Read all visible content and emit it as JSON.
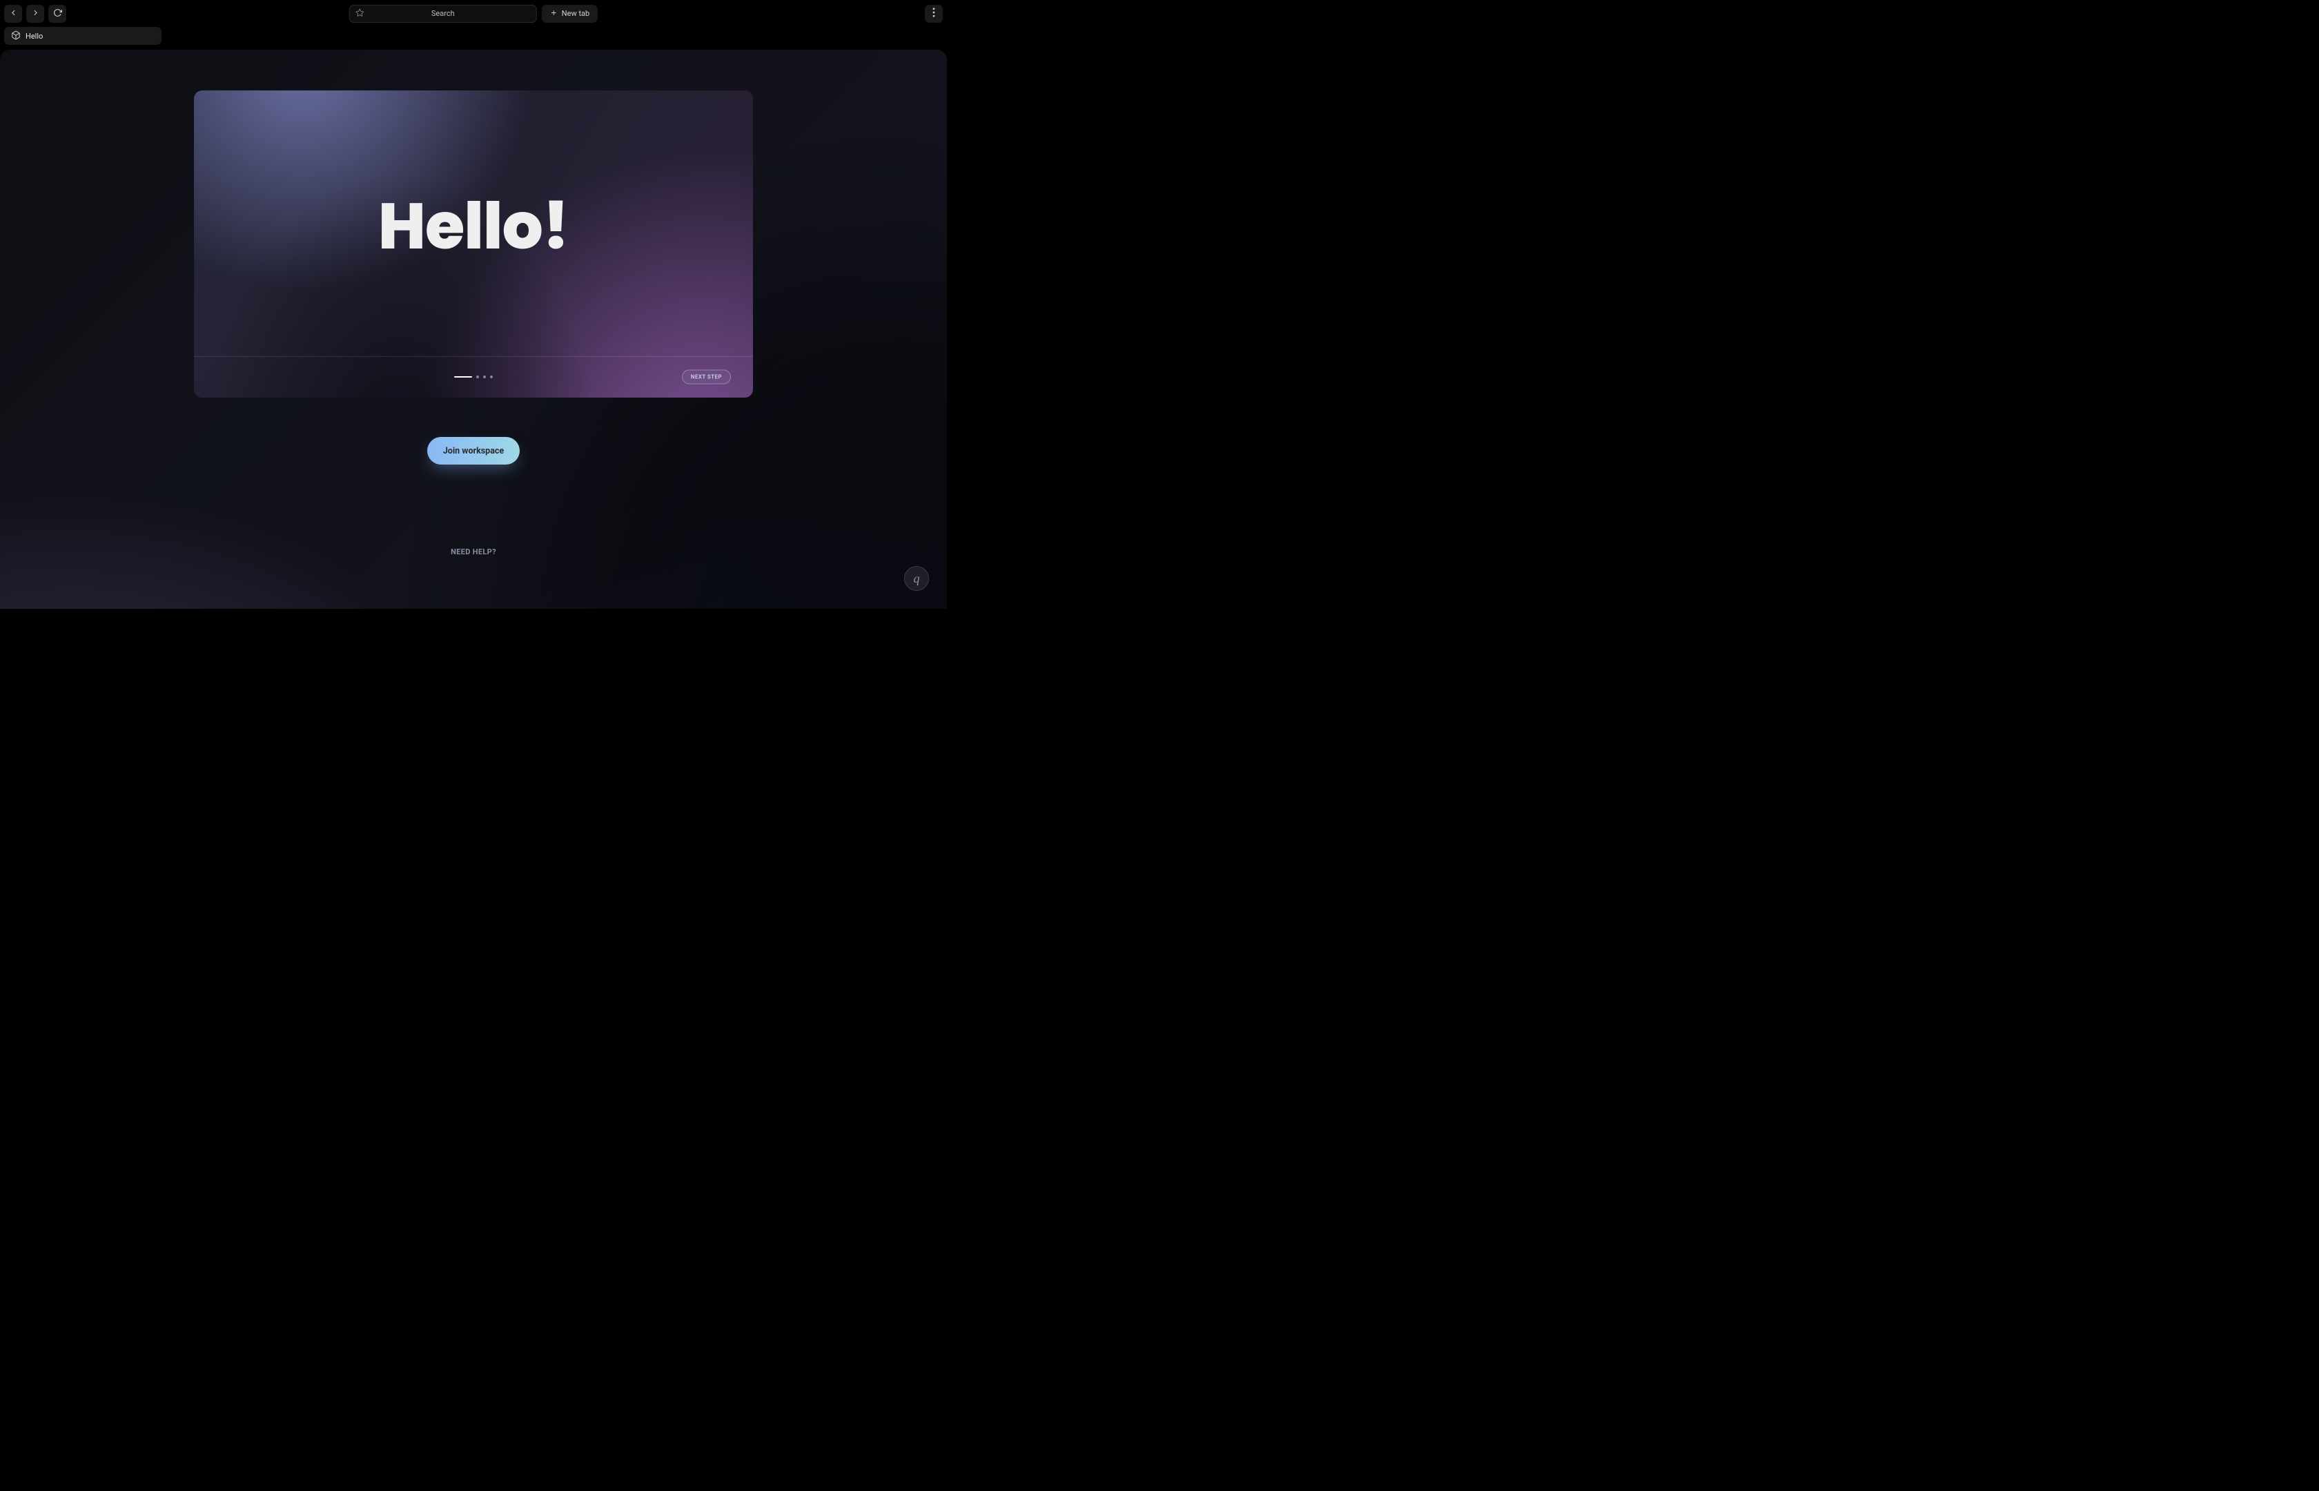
{
  "chrome": {
    "nav": {
      "back_title": "Back",
      "forward_title": "Forward",
      "reload_title": "Reload"
    },
    "search": {
      "placeholder": "Search"
    },
    "new_tab_label": "New tab",
    "kebab_title": "More"
  },
  "tabs": [
    {
      "label": "Hello"
    }
  ],
  "onboarding": {
    "title": "Hello!",
    "next_label": "NEXT STEP",
    "step_index": 0,
    "step_count": 4
  },
  "actions": {
    "join_label": "Join workspace",
    "need_help_label": "NEED HELP?"
  },
  "help_fab": {
    "glyph": "q",
    "title": "Help"
  }
}
